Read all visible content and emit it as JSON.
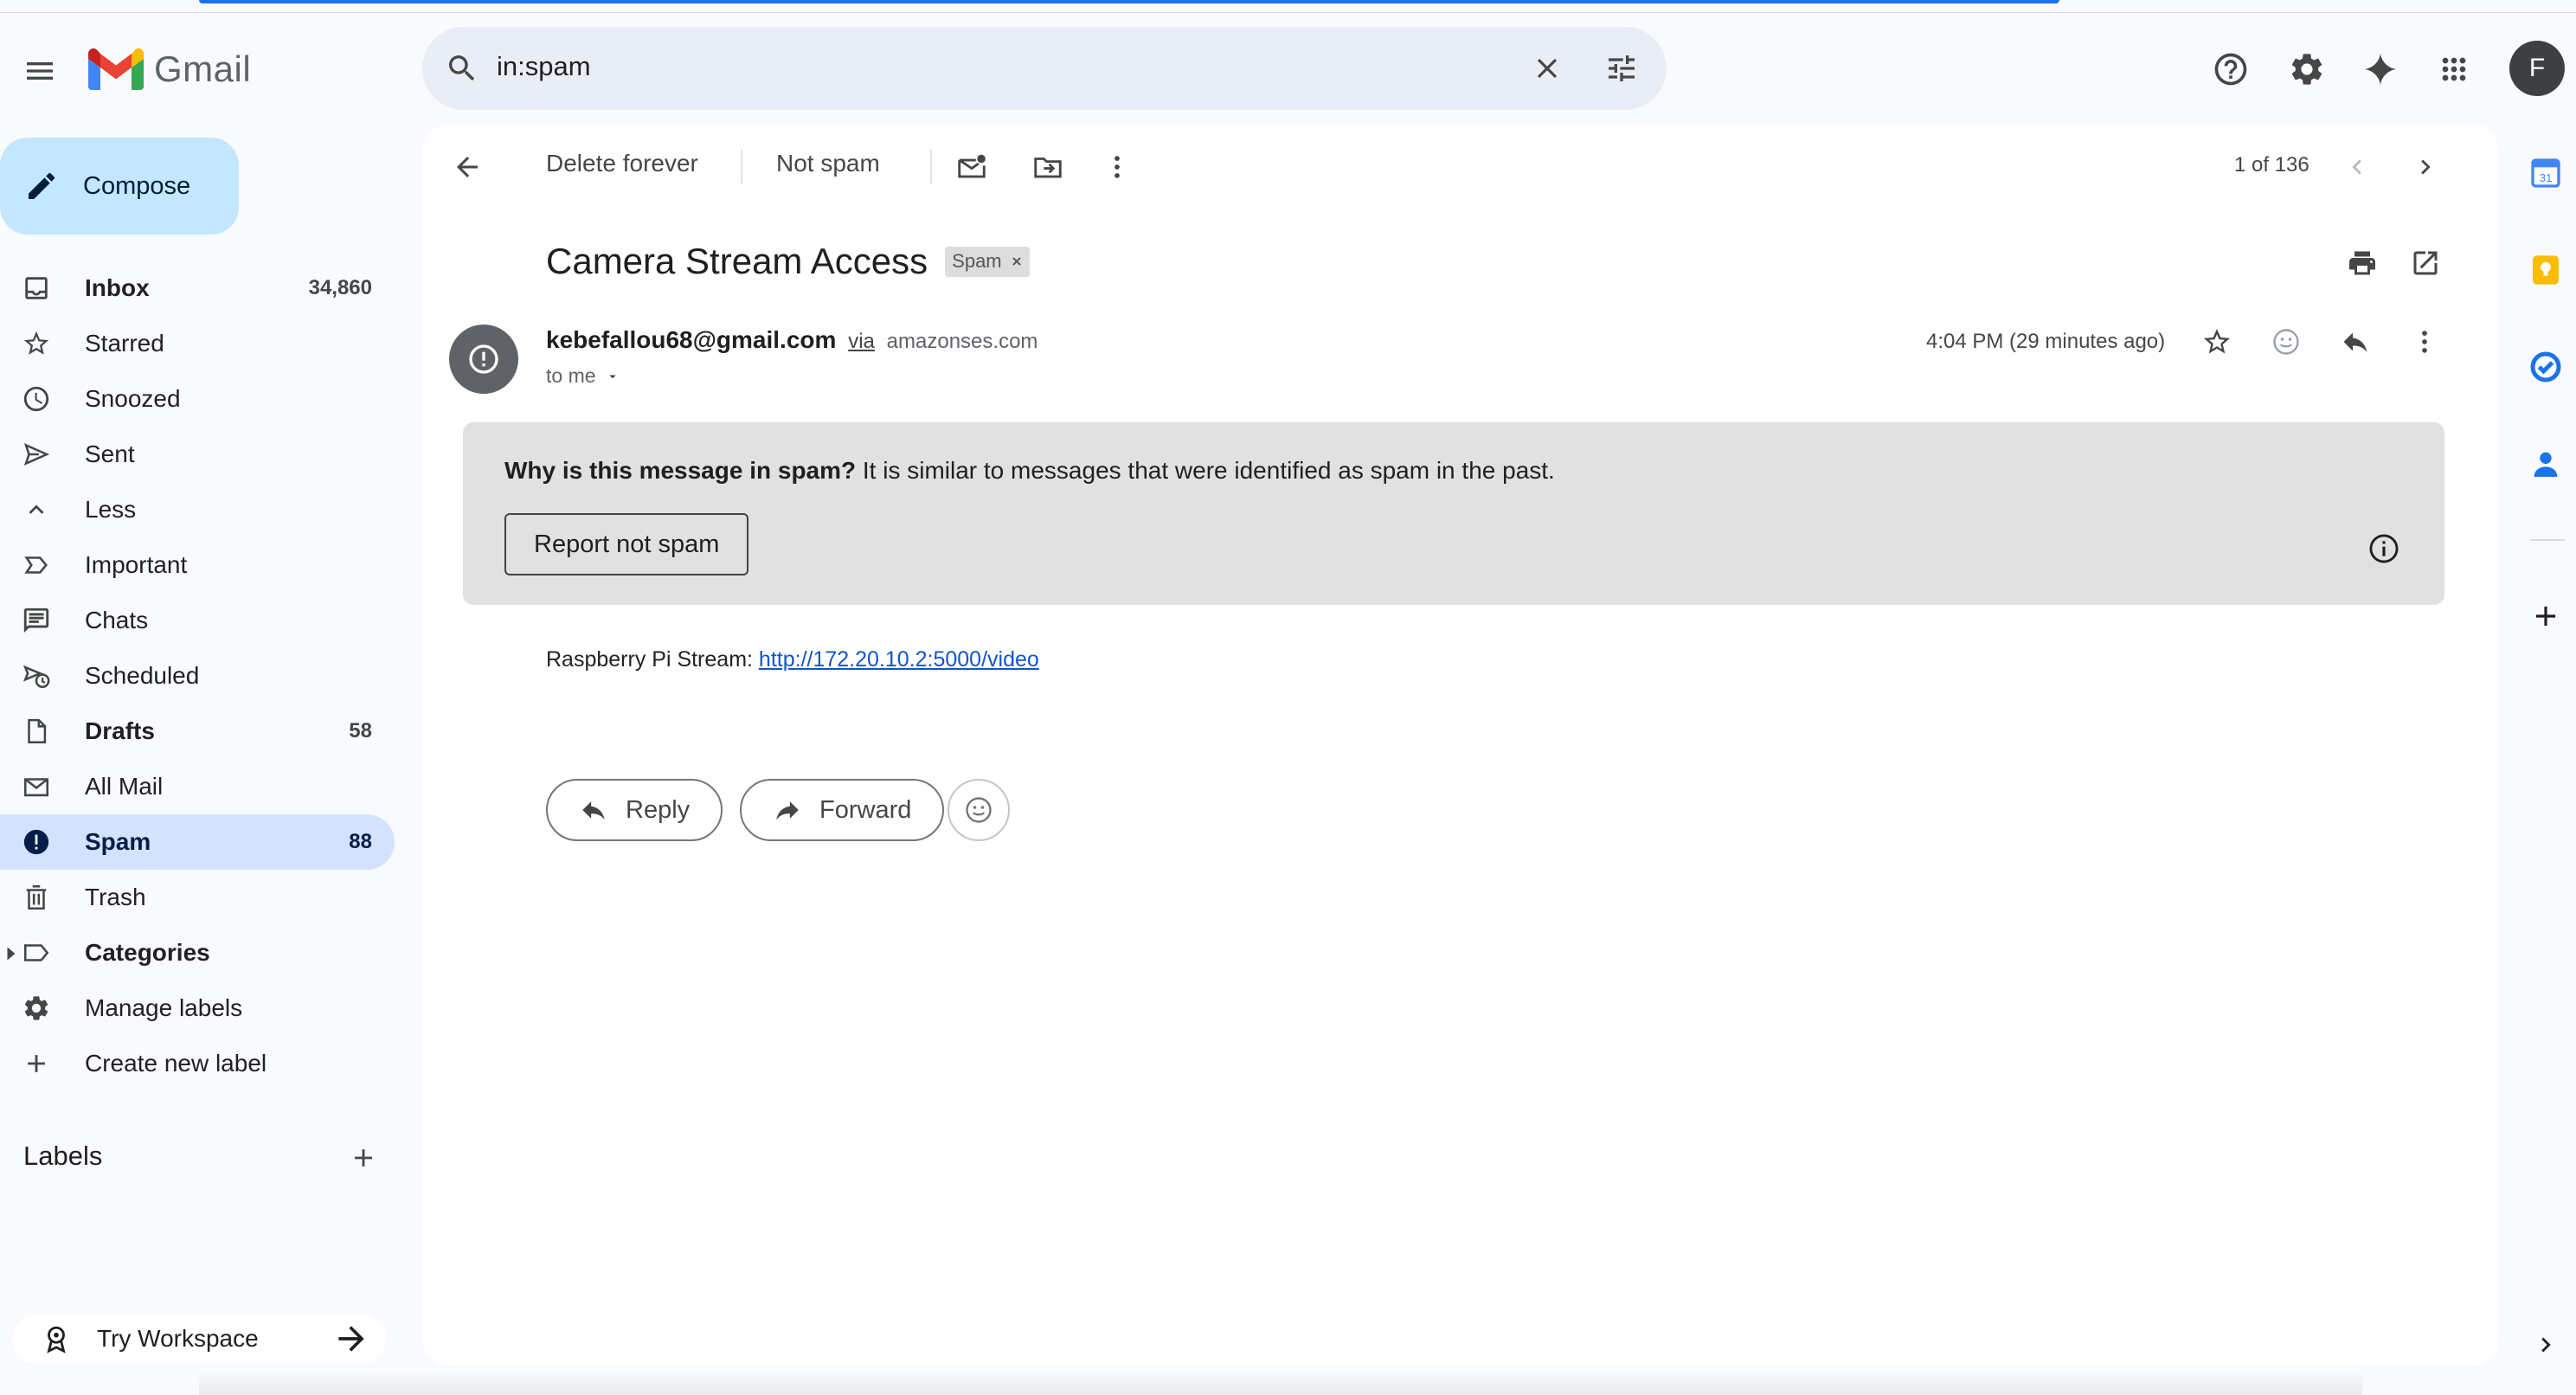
{
  "app": {
    "name": "Gmail"
  },
  "search": {
    "value": "in:spam"
  },
  "account": {
    "initial": "F"
  },
  "sidebar": {
    "compose_label": "Compose",
    "items": [
      {
        "label": "Inbox",
        "count": "34,860",
        "icon": "inbox-icon",
        "bold": true
      },
      {
        "label": "Starred",
        "count": "",
        "icon": "star-icon"
      },
      {
        "label": "Snoozed",
        "count": "",
        "icon": "clock-icon"
      },
      {
        "label": "Sent",
        "count": "",
        "icon": "send-icon"
      },
      {
        "label": "Less",
        "count": "",
        "icon": "chevron-up-icon"
      },
      {
        "label": "Important",
        "count": "",
        "icon": "important-icon"
      },
      {
        "label": "Chats",
        "count": "",
        "icon": "chat-icon"
      },
      {
        "label": "Scheduled",
        "count": "",
        "icon": "scheduled-send-icon"
      },
      {
        "label": "Drafts",
        "count": "58",
        "icon": "draft-icon",
        "bold": true
      },
      {
        "label": "All Mail",
        "count": "",
        "icon": "all-mail-icon"
      },
      {
        "label": "Spam",
        "count": "88",
        "icon": "spam-icon",
        "active": true
      },
      {
        "label": "Trash",
        "count": "",
        "icon": "trash-icon"
      },
      {
        "label": "Categories",
        "count": "",
        "icon": "label-icon",
        "bold": true
      },
      {
        "label": "Manage labels",
        "count": "",
        "icon": "gear-icon"
      },
      {
        "label": "Create new label",
        "count": "",
        "icon": "plus-icon"
      }
    ],
    "labels_header": "Labels",
    "workspace_label": "Try Workspace"
  },
  "toolbar": {
    "delete_forever": "Delete forever",
    "not_spam": "Not spam",
    "pager": "1 of 136"
  },
  "message": {
    "subject": "Camera Stream Access",
    "tag": "Spam",
    "sender_email": "kebefallou68@gmail.com",
    "via_label": "via",
    "via_domain": "amazonses.com",
    "recipient": "to me",
    "time": "4:04 PM (29 minutes ago)",
    "warning_bold": "Why is this message in spam?",
    "warning_text": " It is similar to messages that were identified as spam in the past.",
    "report_button": "Report not spam",
    "body_prefix": "Raspberry Pi Stream: ",
    "body_link": "http://172.20.10.2:5000/video",
    "reply_label": "Reply",
    "forward_label": "Forward"
  },
  "colors": {
    "accent": "#1a73e8",
    "compose_bg": "#c2e7ff",
    "active_nav_bg": "#d3e3fd",
    "warning_bg": "#e1e1e1",
    "link": "#1155cc"
  }
}
